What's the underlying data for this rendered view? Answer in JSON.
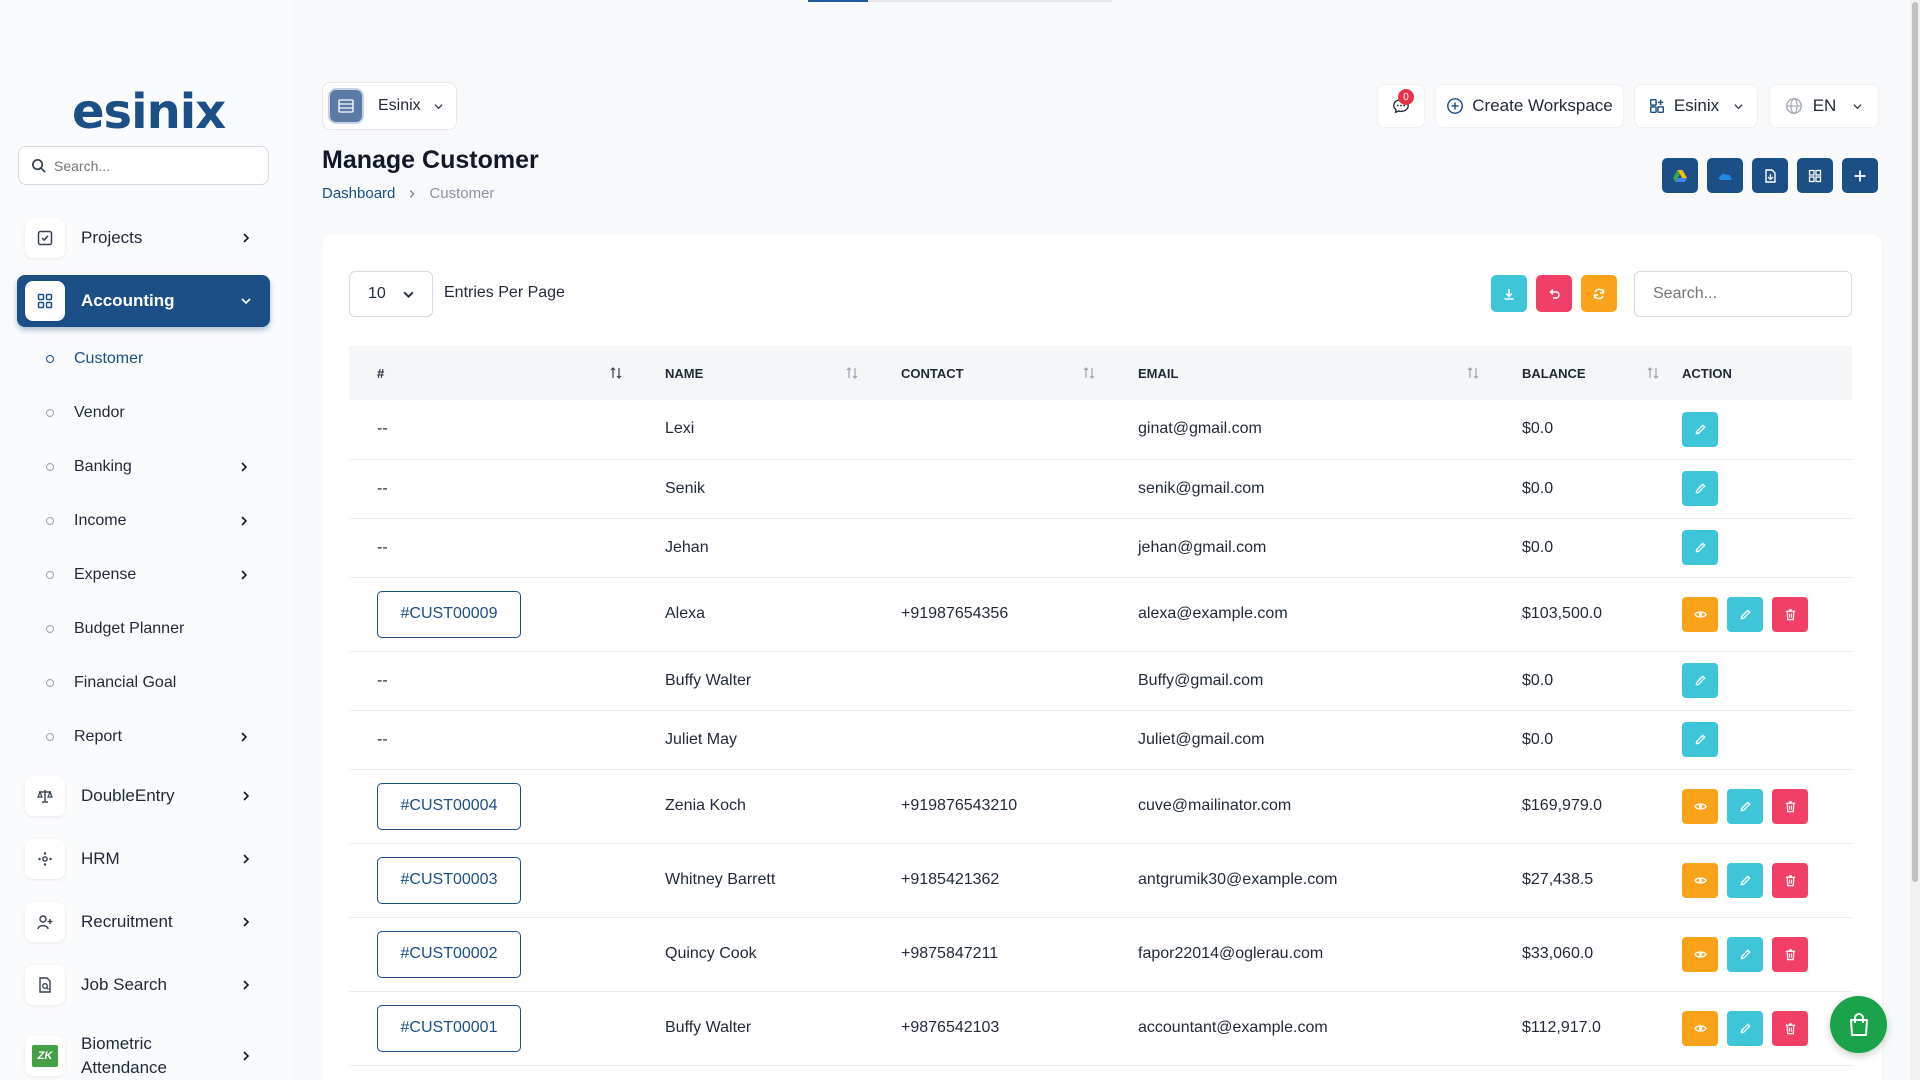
{
  "brand": {
    "logo": "esinix"
  },
  "sidebar": {
    "search_placeholder": "Search...",
    "items": [
      {
        "label": "Projects",
        "icon": "checkbox-icon"
      },
      {
        "label": "Accounting",
        "icon": "grid-icon"
      },
      {
        "label": "DoubleEntry",
        "icon": "scale-icon"
      },
      {
        "label": "HRM",
        "icon": "hrm-icon"
      },
      {
        "label": "Recruitment",
        "icon": "user-plus-icon"
      },
      {
        "label": "Job Search",
        "icon": "doc-search-icon"
      },
      {
        "label": "Biometric Attendance",
        "icon": "zk-icon"
      }
    ],
    "accounting_sub": [
      {
        "label": "Customer"
      },
      {
        "label": "Vendor"
      },
      {
        "label": "Banking"
      },
      {
        "label": "Income"
      },
      {
        "label": "Expense"
      },
      {
        "label": "Budget Planner"
      },
      {
        "label": "Financial Goal"
      },
      {
        "label": "Report"
      }
    ],
    "zk_text": "ZK"
  },
  "header": {
    "workspace_name": "Esinix",
    "notification_count": "0",
    "create_workspace": "Create Workspace",
    "company": "Esinix",
    "language": "EN"
  },
  "page": {
    "title": "Manage Customer",
    "breadcrumb": {
      "home": "Dashboard",
      "current": "Customer"
    }
  },
  "table_controls": {
    "entries_value": "10",
    "entries_label": "Entries Per Page",
    "search_placeholder": "Search..."
  },
  "table": {
    "columns": [
      "#",
      "NAME",
      "CONTACT",
      "EMAIL",
      "BALANCE",
      "ACTION"
    ],
    "rows": [
      {
        "id": "--",
        "name": "Lexi",
        "contact": "",
        "email": "ginat@gmail.com",
        "balance": "$0.0",
        "full": false
      },
      {
        "id": "--",
        "name": "Senik",
        "contact": "",
        "email": "senik@gmail.com",
        "balance": "$0.0",
        "full": false
      },
      {
        "id": "--",
        "name": "Jehan",
        "contact": "",
        "email": "jehan@gmail.com",
        "balance": "$0.0",
        "full": false
      },
      {
        "id": "#CUST00009",
        "name": "Alexa",
        "contact": "+91987654356",
        "email": "alexa@example.com",
        "balance": "$103,500.0",
        "full": true
      },
      {
        "id": "--",
        "name": "Buffy Walter",
        "contact": "",
        "email": "Buffy@gmail.com",
        "balance": "$0.0",
        "full": false
      },
      {
        "id": "--",
        "name": "Juliet May",
        "contact": "",
        "email": "Juliet@gmail.com",
        "balance": "$0.0",
        "full": false
      },
      {
        "id": "#CUST00004",
        "name": "Zenia Koch",
        "contact": "+919876543210",
        "email": "cuve@mailinator.com",
        "balance": "$169,979.0",
        "full": true
      },
      {
        "id": "#CUST00003",
        "name": "Whitney Barrett",
        "contact": "+9185421362",
        "email": "antgrumik30@example.com",
        "balance": "$27,438.5",
        "full": true
      },
      {
        "id": "#CUST00002",
        "name": "Quincy Cook",
        "contact": "+9875847211",
        "email": "fapor22014@oglerau.com",
        "balance": "$33,060.0",
        "full": true
      },
      {
        "id": "#CUST00001",
        "name": "Buffy Walter",
        "contact": "+9876542103",
        "email": "accountant@example.com",
        "balance": "$112,917.0",
        "full": true
      }
    ]
  },
  "colors": {
    "primary": "#1b4f86",
    "view": "#f9a21a",
    "edit": "#3ec6d8",
    "delete": "#f23f65",
    "export": "#3ec6d8",
    "reset": "#f23f65",
    "refresh": "#f9a21a",
    "fab": "#1aa34a"
  }
}
